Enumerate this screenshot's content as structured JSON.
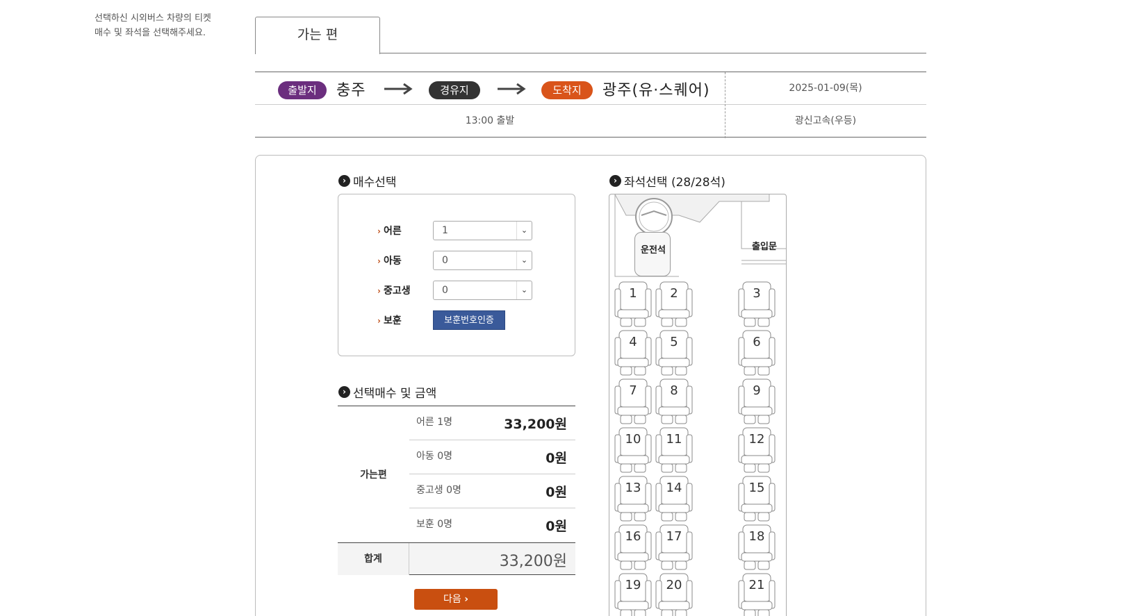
{
  "intro": {
    "line1": "선택하신 시외버스 차량의 티켓",
    "line2": "매수 및 좌석을 선택해주세요."
  },
  "tab": {
    "label": "가는 편"
  },
  "route": {
    "departure_badge": "출발지",
    "departure": "충주",
    "via_badge": "경유지",
    "arrival_badge": "도착지",
    "arrival": "광주(유·스퀘어)",
    "date": "2025-01-09(목)",
    "time": "13:00 출발",
    "company": "광신고속(우등)",
    "colors": {
      "departure": "#6b2e7e",
      "via": "#333333",
      "arrival": "#d9541a"
    }
  },
  "quantity": {
    "title": "매수선택",
    "rows": [
      {
        "label": "어른",
        "value": "1"
      },
      {
        "label": "아동",
        "value": "0"
      },
      {
        "label": "중고생",
        "value": "0"
      }
    ],
    "veteran": {
      "label": "보훈",
      "button": "보훈번호인증"
    }
  },
  "summary": {
    "title": "선택매수 및 금액",
    "side_label": "가는편",
    "rows": [
      {
        "label": "어른 1명",
        "amount": "33,200원"
      },
      {
        "label": "아동 0명",
        "amount": "0원"
      },
      {
        "label": "중고생 0명",
        "amount": "0원"
      },
      {
        "label": "보훈 0명",
        "amount": "0원"
      }
    ],
    "total_label": "합계",
    "total_amount": "33,200원"
  },
  "next_button": "다음",
  "seats": {
    "title": "좌석선택 (28/28석)",
    "driver_label": "운전석",
    "door_label": "출입문",
    "numbers": [
      "1",
      "2",
      "3",
      "4",
      "5",
      "6",
      "7",
      "8",
      "9",
      "10",
      "11",
      "12",
      "13",
      "14",
      "15",
      "16",
      "17",
      "18",
      "19",
      "20",
      "21"
    ]
  }
}
